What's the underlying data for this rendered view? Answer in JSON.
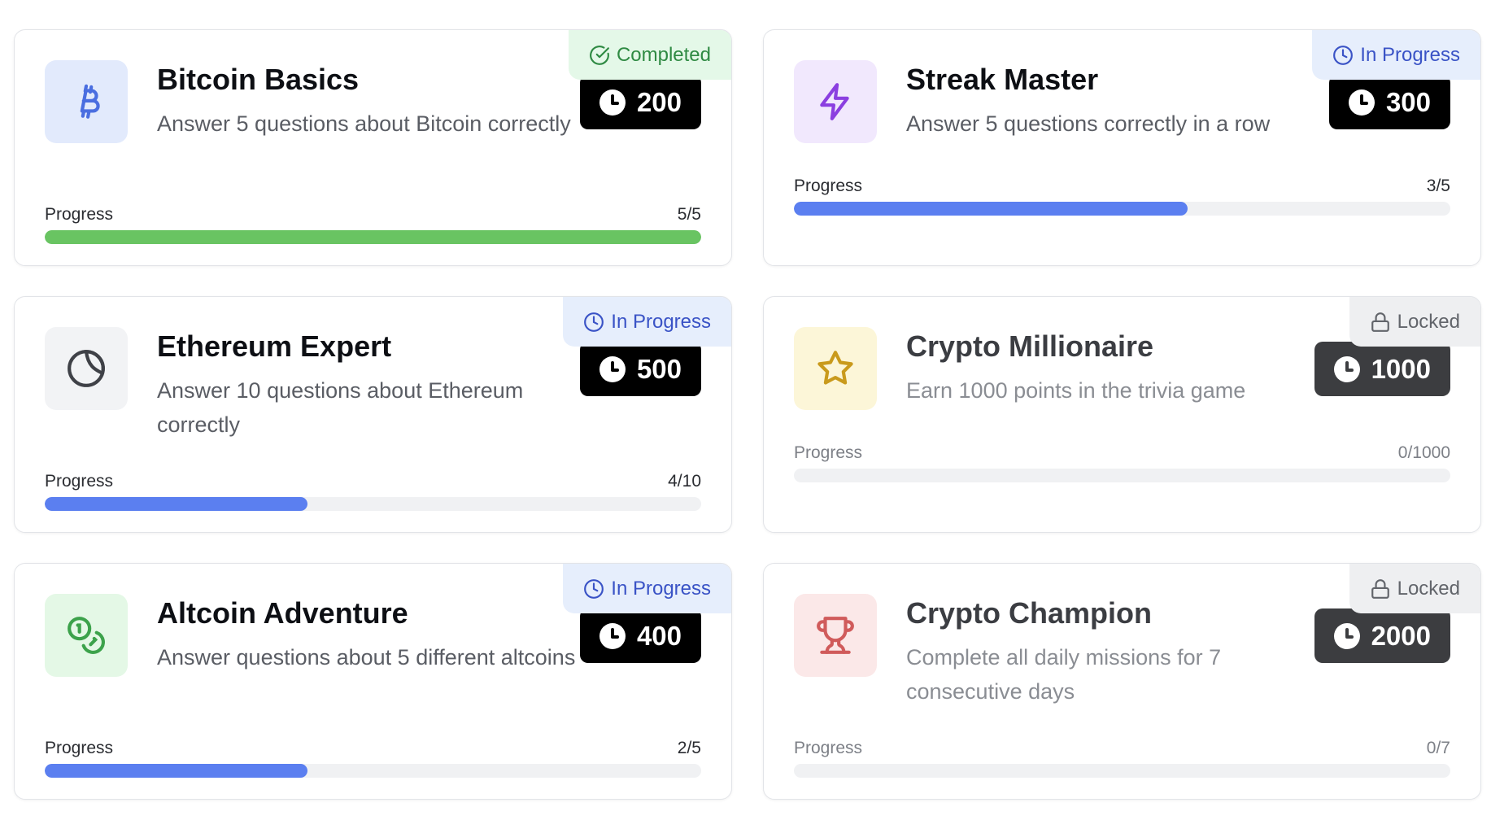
{
  "progress_label": "Progress",
  "colors": {
    "completed_fill": "#69c462",
    "progress_fill": "#5b7ff0",
    "locked_fill": "#f0f1f3"
  },
  "missions": [
    {
      "title": "Bitcoin Basics",
      "description": "Answer 5 questions about Bitcoin correctly",
      "status": "Completed",
      "status_kind": "completed",
      "points": "200",
      "progress_text": "5/5",
      "progress_fraction": 1.0,
      "icon": "bitcoin-icon",
      "icon_bg": "#e2eafc",
      "icon_color": "#4a6ee0"
    },
    {
      "title": "Streak Master",
      "description": "Answer 5 questions correctly in a row",
      "status": "In Progress",
      "status_kind": "progress",
      "points": "300",
      "progress_text": "3/5",
      "progress_fraction": 0.6,
      "icon": "lightning-icon",
      "icon_bg": "#f1e8fd",
      "icon_color": "#8b3fe0"
    },
    {
      "title": "Ethereum Expert",
      "description": "Answer 10 questions about Ethereum correctly",
      "status": "In Progress",
      "status_kind": "progress",
      "points": "500",
      "progress_text": "4/10",
      "progress_fraction": 0.4,
      "icon": "pie-chart-icon",
      "icon_bg": "#f2f3f5",
      "icon_color": "#3f4147"
    },
    {
      "title": "Crypto Millionaire",
      "description": "Earn 1000 points in the trivia game",
      "status": "Locked",
      "status_kind": "locked",
      "points": "1000",
      "progress_text": "0/1000",
      "progress_fraction": 0.0,
      "icon": "star-icon",
      "icon_bg": "#fcf6d8",
      "icon_color": "#c99a1c"
    },
    {
      "title": "Altcoin Adventure",
      "description": "Answer questions about 5 different altcoins",
      "status": "In Progress",
      "status_kind": "progress",
      "points": "400",
      "progress_text": "2/5",
      "progress_fraction": 0.4,
      "icon": "coins-icon",
      "icon_bg": "#e4f8e6",
      "icon_color": "#3ca24b"
    },
    {
      "title": "Crypto Champion",
      "description": "Complete all daily missions for 7 consecutive days",
      "status": "Locked",
      "status_kind": "locked",
      "points": "2000",
      "progress_text": "0/7",
      "progress_fraction": 0.0,
      "icon": "trophy-icon",
      "icon_bg": "#fbe8e8",
      "icon_color": "#d05b5b"
    }
  ]
}
